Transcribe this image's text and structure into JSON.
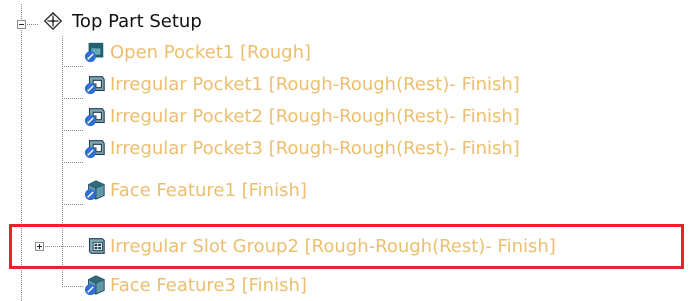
{
  "tree": {
    "root": {
      "label": "Top Part Setup",
      "icon": "setup-axes-icon",
      "expanded": true
    },
    "items": [
      {
        "label": "Open Pocket1 [Rough]",
        "icon": "open-pocket-icon"
      },
      {
        "label": "Irregular Pocket1 [Rough-Rough(Rest)- Finish]",
        "icon": "irregular-pocket-icon"
      },
      {
        "label": "Irregular Pocket2 [Rough-Rough(Rest)- Finish]",
        "icon": "irregular-pocket-icon"
      },
      {
        "label": "Irregular Pocket3 [Rough-Rough(Rest)- Finish]",
        "icon": "irregular-pocket-icon"
      },
      {
        "label": "Face Feature1 [Finish]",
        "icon": "face-feature-icon"
      },
      {
        "label": "Irregular Slot Group2 [Rough-Rough(Rest)- Finish]",
        "icon": "slot-group-icon",
        "expandable": true,
        "expanded": false,
        "highlighted": true
      },
      {
        "label": "Face Feature3 [Finish]",
        "icon": "face-feature-icon"
      }
    ]
  },
  "colors": {
    "feature_label": "#ecbe6e",
    "root_label": "#111111",
    "highlight_border": "#e8212b",
    "icon_dark": "#1f5f6f",
    "icon_blue": "#2f6fd6"
  }
}
